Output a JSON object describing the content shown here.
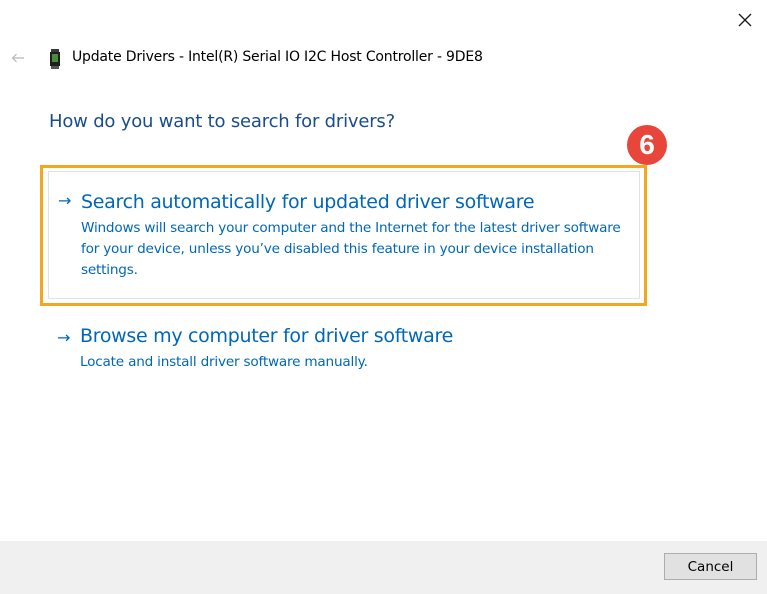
{
  "window": {
    "title": "Update Drivers - Intel(R) Serial IO I2C Host Controller - 9DE8",
    "close_icon": "close-icon",
    "back_icon": "back-arrow-icon",
    "device_icon": "device-icon"
  },
  "main": {
    "heading": "How do you want to search for drivers?",
    "options": [
      {
        "arrow": "→",
        "title": "Search automatically for updated driver software",
        "description": "Windows will search your computer and the Internet for the latest driver software for your device, unless you’ve disabled this feature in your device installation settings."
      },
      {
        "arrow": "→",
        "title": "Browse my computer for driver software",
        "description": "Locate and install driver software manually."
      }
    ]
  },
  "annotation": {
    "step_number": "6",
    "highlight_color": "#f0a81c",
    "badge_color": "#e8463a"
  },
  "footer": {
    "cancel_label": "Cancel"
  },
  "colors": {
    "link_blue": "#0067b8",
    "heading_blue": "#1a4d8c",
    "footer_bg": "#f0f0f0"
  }
}
